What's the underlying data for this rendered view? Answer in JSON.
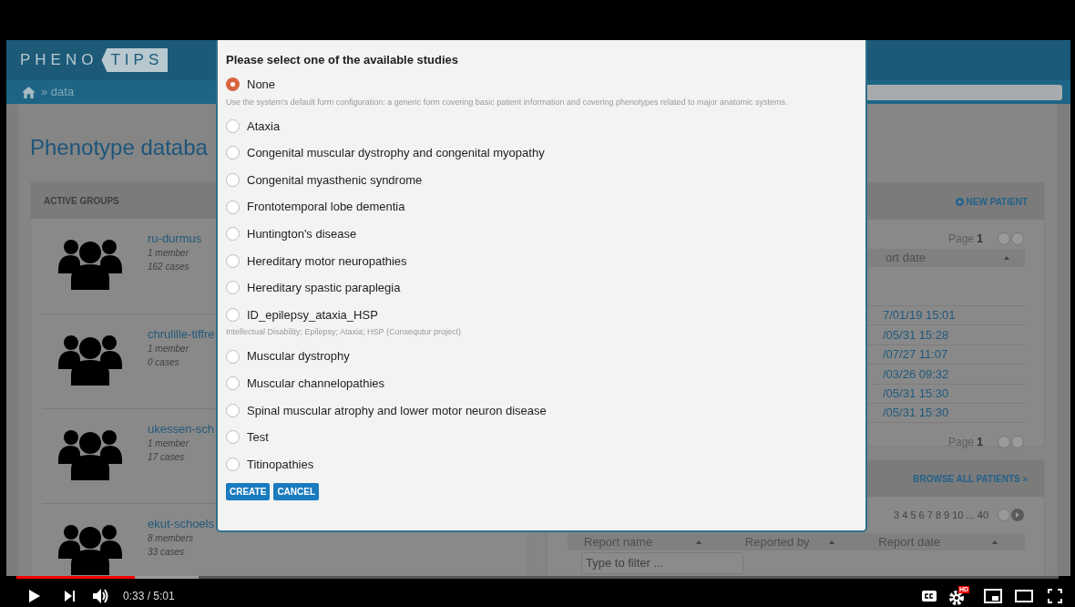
{
  "page": {
    "logo": {
      "left": "PHENO",
      "right": "TIPS"
    },
    "breadcrumb": "» data",
    "title": "Phenotype databa",
    "groups_panel": {
      "heading": "ACTIVE GROUPS",
      "groups": [
        {
          "name": "ru-durmus",
          "members": "1 member",
          "cases": "162 cases"
        },
        {
          "name": "chrulille-tiffre",
          "members": "1 member",
          "cases": "0 cases"
        },
        {
          "name": "ukessen-sch",
          "members": "1 member",
          "cases": "17 cases"
        },
        {
          "name": "ekut-schoels",
          "members": "8 members",
          "cases": "33 cases"
        }
      ]
    },
    "patients_panel": {
      "action": "NEW PATIENT",
      "page_top": "Page",
      "page_top_number": "1",
      "column": "ort date",
      "dates": [
        "7/01/19 15:01",
        "/05/31 15:28",
        "/07/27 11:07",
        "/03/26 09:32",
        "/05/31 15:30",
        "/05/31 15:30"
      ],
      "page_bottom": "Page",
      "page_bottom_number": "1"
    },
    "browse_panel": {
      "action": "BROWSE ALL PATIENTS »",
      "pages": "3 4 5 6 7 8 9 10 ... 40",
      "columns": [
        "Report name",
        "Reported by",
        "Report date"
      ],
      "filter": {
        "placeholder": "Type to filter ..."
      }
    }
  },
  "dialog": {
    "title": "Please select one of the available studies",
    "options": [
      {
        "label": "None",
        "selected": true,
        "description": "Use the system's default form configuration: a generic form covering basic patient information and covering phenotypes related to major anatomic systems."
      },
      {
        "label": "Ataxia",
        "selected": false
      },
      {
        "label": "Congenital muscular dystrophy and congenital myopathy",
        "selected": false
      },
      {
        "label": "Congenital myasthenic syndrome",
        "selected": false
      },
      {
        "label": "Frontotemporal lobe dementia",
        "selected": false
      },
      {
        "label": "Huntington's disease",
        "selected": false
      },
      {
        "label": "Hereditary motor neuropathies",
        "selected": false
      },
      {
        "label": "Hereditary spastic paraplegia",
        "selected": false
      },
      {
        "label": "ID_epilepsy_ataxia_HSP",
        "selected": false,
        "description": "Intellectual Disability; Epilepsy; Ataxia; HSP (Consequtur project)"
      },
      {
        "label": "Muscular dystrophy",
        "selected": false
      },
      {
        "label": "Muscular channelopathies",
        "selected": false
      },
      {
        "label": "Spinal muscular atrophy and lower motor neuron disease",
        "selected": false
      },
      {
        "label": "Test",
        "selected": false
      },
      {
        "label": "Titinopathies",
        "selected": false
      }
    ],
    "buttons": [
      "CREATE",
      "CANCEL"
    ]
  },
  "player": {
    "time": "0:33 / 5:01",
    "level": 0.114,
    "hd_badge": "HD"
  }
}
